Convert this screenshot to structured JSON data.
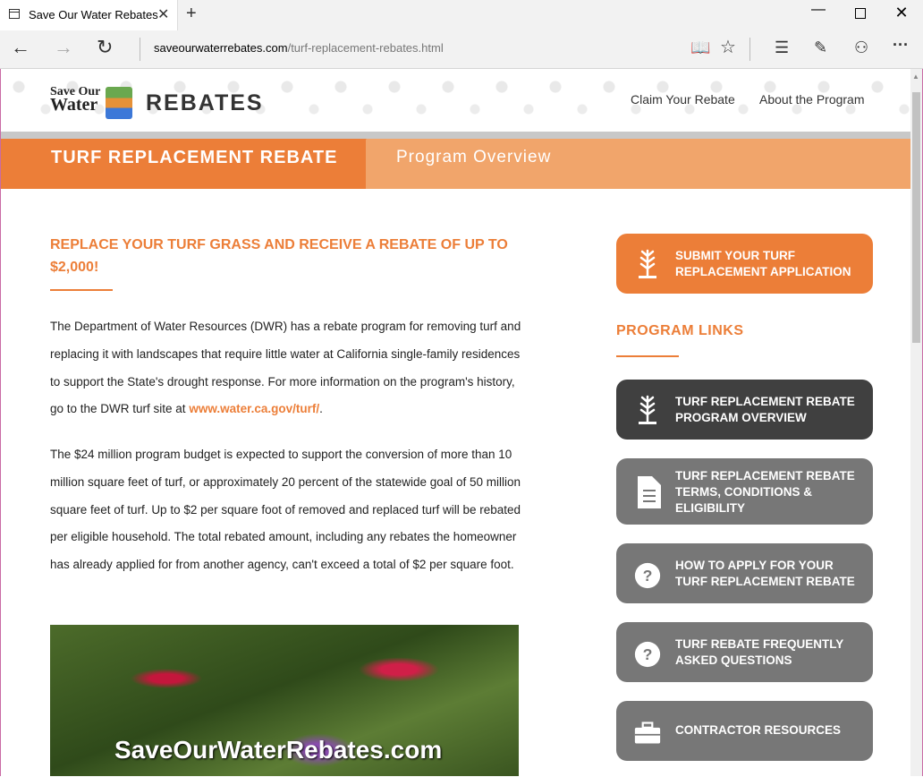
{
  "browser": {
    "tab_title": "Save Our Water Rebates",
    "close_tab": "✕",
    "new_tab": "+",
    "url_host": "saveourwaterrebates.com",
    "url_path": "/turf-replacement-rebates.html",
    "min": "—",
    "close": "✕",
    "back": "←",
    "forward": "→",
    "refresh": "↻",
    "reading_view": "📖",
    "favorite": "☆",
    "hub": "☰",
    "note": "✎",
    "share": "⚇",
    "more": "···"
  },
  "header": {
    "logo_line1": "Save Our",
    "logo_line2": "Water",
    "logo_rebates": "REBATES",
    "nav": [
      "Claim Your Rebate",
      "About the Program"
    ]
  },
  "band": {
    "title": "TURF REPLACEMENT REBATE",
    "subtitle": "Program Overview"
  },
  "main": {
    "headline": "REPLACE YOUR TURF GRASS AND RECEIVE A REBATE OF UP TO $2,000!",
    "para1_text": "The Department of Water Resources (DWR) has a rebate program for removing turf and replacing it with landscapes that require little water at California single-family residences to support the State's drought response. For more information on the program's history, go to the DWR turf site at ",
    "para1_link": "www.water.ca.gov/turf/",
    "para1_end": ".",
    "para2": "The $24 million program budget is expected to support the conversion of more than 10 million square feet of turf, or approximately 20 percent of the statewide goal of 50 million square feet of turf. Up to $2 per square foot of removed and replaced turf will be rebated per eligible household. The total rebated amount, including any rebates the homeowner has already applied for from another agency, can't exceed a total of $2 per square foot.",
    "photo_caption": "SaveOurWaterRebates.com"
  },
  "sidebar": {
    "submit_line1": "SUBMIT YOUR TURF",
    "submit_line2": "REPLACEMENT APPLICATION",
    "links_title": "PROGRAM LINKS",
    "links": [
      {
        "line1": "TURF REPLACEMENT REBATE",
        "line2": "PROGRAM OVERVIEW",
        "line3": ""
      },
      {
        "line1": "TURF REPLACEMENT REBATE",
        "line2": "TERMS, CONDITIONS &",
        "line3": "ELIGIBILITY"
      },
      {
        "line1": "HOW TO APPLY FOR YOUR",
        "line2": "TURF REPLACEMENT REBATE",
        "line3": ""
      },
      {
        "line1": "TURF REBATE FREQUENTLY",
        "line2": "ASKED QUESTIONS",
        "line3": ""
      },
      {
        "line1": "CONTRACTOR RESOURCES",
        "line2": "",
        "line3": ""
      }
    ]
  },
  "colors": {
    "accent": "#ec7e38",
    "accent_light": "#f1a56b",
    "button_dark": "#404040",
    "button_gray": "#777777"
  }
}
